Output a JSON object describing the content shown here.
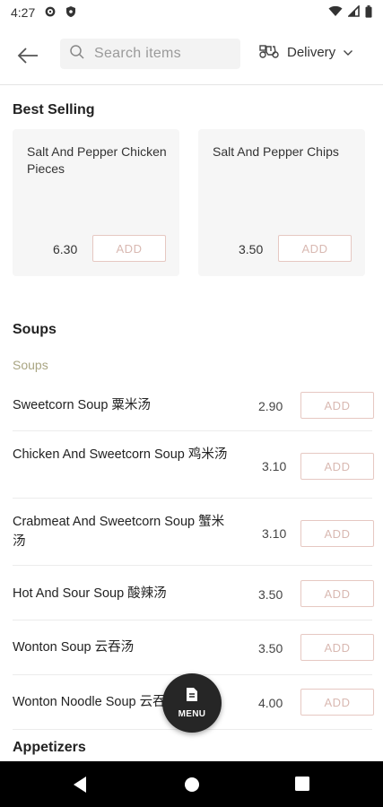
{
  "status_bar": {
    "time": "4:27"
  },
  "header": {
    "search_placeholder": "Search items",
    "delivery_label": "Delivery"
  },
  "best_selling": {
    "title": "Best Selling",
    "items": [
      {
        "name": "Salt And Pepper Chicken Pieces",
        "price": "6.30",
        "add_label": "ADD"
      },
      {
        "name": "Salt And Pepper Chips",
        "price": "3.50",
        "add_label": "ADD"
      }
    ]
  },
  "soups": {
    "title": "Soups",
    "subtitle": "Soups",
    "items": [
      {
        "name": "Sweetcorn Soup 粟米汤",
        "price": "2.90",
        "add_label": "ADD"
      },
      {
        "name": "Chicken And Sweetcorn Soup 鸡米汤",
        "price": "3.10",
        "add_label": "ADD"
      },
      {
        "name": "Crabmeat And Sweetcorn Soup 蟹米汤",
        "price": "3.10",
        "add_label": "ADD"
      },
      {
        "name": "Hot And Sour Soup 酸辣汤",
        "price": "3.50",
        "add_label": "ADD"
      },
      {
        "name": "Wonton Soup 云吞汤",
        "price": "3.50",
        "add_label": "ADD"
      },
      {
        "name": "Wonton Noodle Soup 云吞面",
        "price": "4.00",
        "add_label": "ADD"
      }
    ]
  },
  "appetizers": {
    "title": "Appetizers"
  },
  "fab": {
    "label": "MENU"
  },
  "colors": {
    "add_border": "#e6c8c2",
    "add_text": "#d9b9b2",
    "subtitle": "#a9a582",
    "fab_bg": "#262626"
  }
}
